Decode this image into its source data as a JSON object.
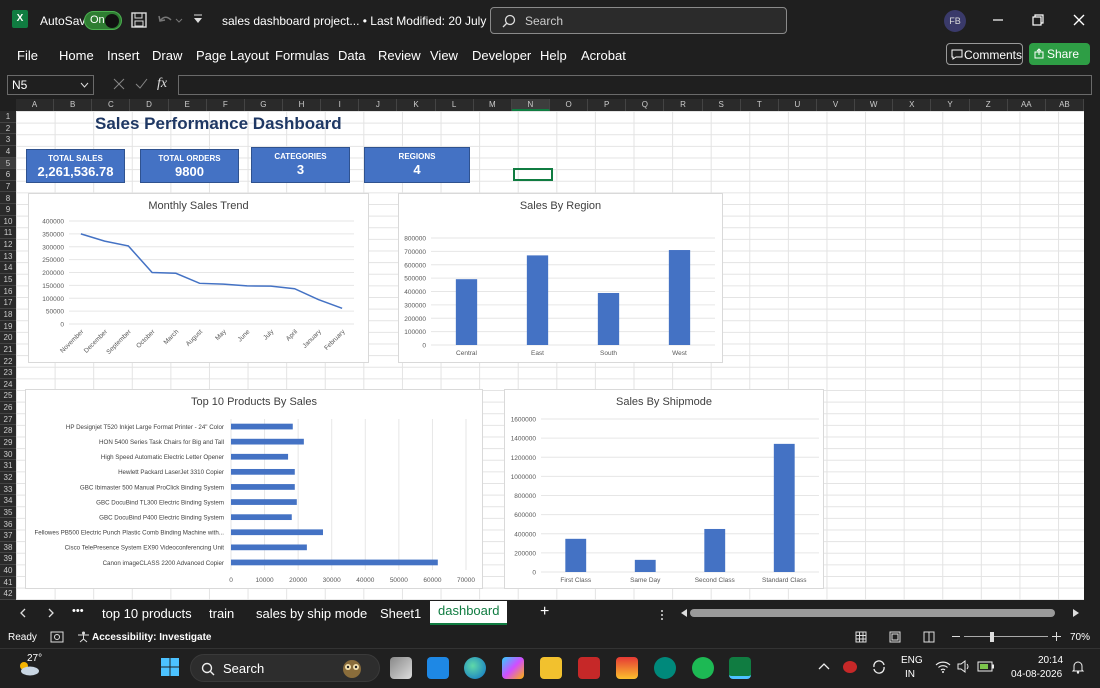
{
  "titlebar": {
    "autosave_label": "AutoSave",
    "autosave_state": "On",
    "doc_title": "sales dashboard project... • Last Modified: 20 July",
    "search_placeholder": "Search",
    "user_initials": "FB"
  },
  "menu": {
    "items": [
      "File",
      "Home",
      "Insert",
      "Draw",
      "Page Layout",
      "Formulas",
      "Data",
      "Review",
      "View",
      "Developer",
      "Help",
      "Acrobat"
    ],
    "comments_label": "Comments",
    "share_label": "Share"
  },
  "formula_bar": {
    "name_box": "N5",
    "fx_label": "fx",
    "content": ""
  },
  "grid": {
    "columns": [
      "A",
      "B",
      "C",
      "D",
      "E",
      "F",
      "G",
      "H",
      "I",
      "J",
      "K",
      "L",
      "M",
      "N",
      "O",
      "P",
      "Q",
      "R",
      "S",
      "T",
      "U",
      "V",
      "W",
      "X",
      "Y",
      "Z",
      "AA",
      "AB"
    ],
    "rows": [
      "1",
      "2",
      "3",
      "4",
      "5",
      "6",
      "7",
      "8",
      "9",
      "10",
      "11",
      "12",
      "13",
      "14",
      "15",
      "16",
      "17",
      "18",
      "19",
      "20",
      "21",
      "22",
      "23",
      "24",
      "25",
      "26",
      "27",
      "28",
      "29",
      "30",
      "31",
      "32",
      "33",
      "34",
      "35",
      "36",
      "37",
      "38",
      "39",
      "40",
      "41",
      "42"
    ],
    "selected_cell": "N5"
  },
  "dashboard": {
    "title": "Sales Performance Dashboard",
    "kpis": [
      {
        "label": "TOTAL SALES",
        "value": "2,261,536.78"
      },
      {
        "label": "TOTAL ORDERS",
        "value": "9800"
      },
      {
        "label": "CATEGORIES",
        "value": "3"
      },
      {
        "label": "REGIONS",
        "value": "4"
      }
    ]
  },
  "chart_data": [
    {
      "type": "line",
      "title": "Monthly Sales Trend",
      "categories": [
        "November",
        "December",
        "September",
        "October",
        "March",
        "August",
        "May",
        "June",
        "July",
        "April",
        "January",
        "February"
      ],
      "values": [
        350000,
        322000,
        303000,
        200000,
        197000,
        158000,
        155000,
        148000,
        147000,
        137000,
        95000,
        61000
      ],
      "yticks": [
        "0",
        "50000",
        "100000",
        "150000",
        "200000",
        "250000",
        "300000",
        "350000",
        "400000"
      ],
      "ylim": [
        0,
        400000
      ],
      "color": "#4472c4"
    },
    {
      "type": "bar",
      "title": "Sales By Region",
      "categories": [
        "Central",
        "East",
        "South",
        "West"
      ],
      "values": [
        492000,
        670000,
        389000,
        710000
      ],
      "yticks": [
        "0",
        "100000",
        "200000",
        "300000",
        "400000",
        "500000",
        "600000",
        "700000",
        "800000"
      ],
      "ylim": [
        0,
        800000
      ],
      "color": "#4472c4"
    },
    {
      "type": "bar",
      "orientation": "horizontal",
      "title": "Top 10 Products By Sales",
      "categories": [
        "HP Designjet T520 Inkjet Large Format Printer - 24\" Color",
        "HON 5400 Series Task Chairs for Big and Tall",
        "High Speed Automatic Electric Letter Opener",
        "Hewlett Packard LaserJet 3310 Copier",
        "GBC Ibimaster 500 Manual ProClick Binding System",
        "GBC DocuBind TL300 Electric Binding System",
        "GBC DocuBind P400 Electric Binding System",
        "Fellowes PB500 Electric Punch Plastic Comb Binding Machine with...",
        "Cisco TelePresence System EX90 Videoconferencing Unit",
        "Canon imageCLASS 2200 Advanced Copier"
      ],
      "values": [
        18400,
        21700,
        17000,
        19000,
        19000,
        19600,
        18100,
        27400,
        22600,
        61600
      ],
      "xticks": [
        "0",
        "10000",
        "20000",
        "30000",
        "40000",
        "50000",
        "60000",
        "70000"
      ],
      "xlim": [
        0,
        70000
      ],
      "color": "#4472c4"
    },
    {
      "type": "bar",
      "title": "Sales By Shipmode",
      "categories": [
        "First Class",
        "Same Day",
        "Second Class",
        "Standard Class"
      ],
      "values": [
        347000,
        127000,
        450000,
        1340000
      ],
      "yticks": [
        "0",
        "200000",
        "400000",
        "600000",
        "800000",
        "1000000",
        "1200000",
        "1400000",
        "1600000"
      ],
      "ylim": [
        0,
        1600000
      ],
      "color": "#4472c4"
    }
  ],
  "sheet_tabs": {
    "more": "•••",
    "tabs": [
      "top 10 products",
      "train",
      "sales by ship mode",
      "Sheet1",
      "dashboard"
    ],
    "active": "dashboard",
    "add": "+"
  },
  "status": {
    "ready": "Ready",
    "accessibility": "Accessibility: Investigate",
    "zoom": "70%"
  },
  "taskbar": {
    "weather_temp": "27°",
    "search_label": "Search",
    "lang_top": "ENG",
    "lang_bottom": "IN",
    "time": "20:14",
    "date": "04-08-2026"
  }
}
